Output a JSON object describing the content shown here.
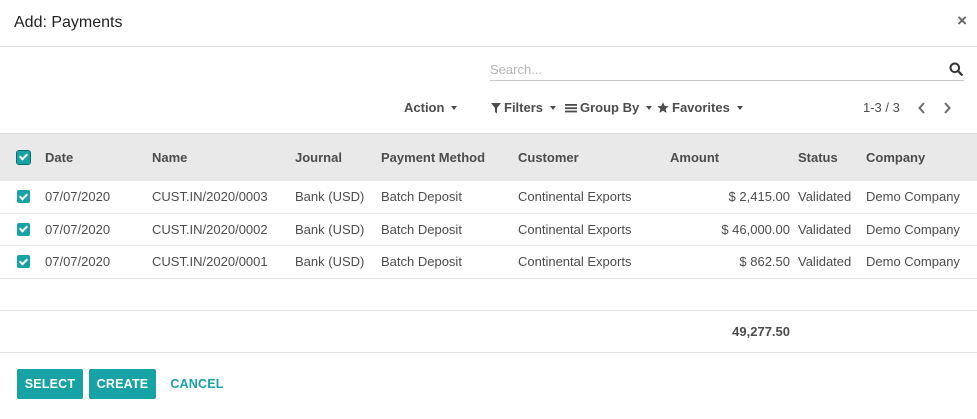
{
  "modal": {
    "title": "Add: Payments",
    "close_label": "×"
  },
  "search": {
    "placeholder": "Search...",
    "value": ""
  },
  "control_panel": {
    "action_label": "Action",
    "filters_label": "Filters",
    "group_by_label": "Group By",
    "favorites_label": "Favorites",
    "pager": "1-3 / 3"
  },
  "table": {
    "columns": {
      "date": "Date",
      "name": "Name",
      "journal": "Journal",
      "payment_method": "Payment Method",
      "customer": "Customer",
      "amount": "Amount",
      "status": "Status",
      "company": "Company"
    },
    "select_all_checked": true,
    "rows": [
      {
        "checked": true,
        "date": "07/07/2020",
        "name": "CUST.IN/2020/0003",
        "journal": "Bank (USD)",
        "payment_method": "Batch Deposit",
        "customer": "Continental Exports",
        "amount": "$ 2,415.00",
        "status": "Validated",
        "company": "Demo Company"
      },
      {
        "checked": true,
        "date": "07/07/2020",
        "name": "CUST.IN/2020/0002",
        "journal": "Bank (USD)",
        "payment_method": "Batch Deposit",
        "customer": "Continental Exports",
        "amount": "$ 46,000.00",
        "status": "Validated",
        "company": "Demo Company"
      },
      {
        "checked": true,
        "date": "07/07/2020",
        "name": "CUST.IN/2020/0001",
        "journal": "Bank (USD)",
        "payment_method": "Batch Deposit",
        "customer": "Continental Exports",
        "amount": "$ 862.50",
        "status": "Validated",
        "company": "Demo Company"
      }
    ],
    "total_amount": "49,277.50"
  },
  "footer": {
    "select_label": "SELECT",
    "create_label": "CREATE",
    "cancel_label": "CANCEL"
  },
  "colors": {
    "accent": "#17a2a6",
    "header_bg": "#e9e9e9",
    "text": "#4c4c4c"
  },
  "icons": {
    "search": "search-icon",
    "filter": "filter-icon",
    "group_by": "list-icon",
    "favorites": "star-icon",
    "pager_prev": "chevron-left-icon",
    "pager_next": "chevron-right-icon",
    "close": "close-icon"
  }
}
